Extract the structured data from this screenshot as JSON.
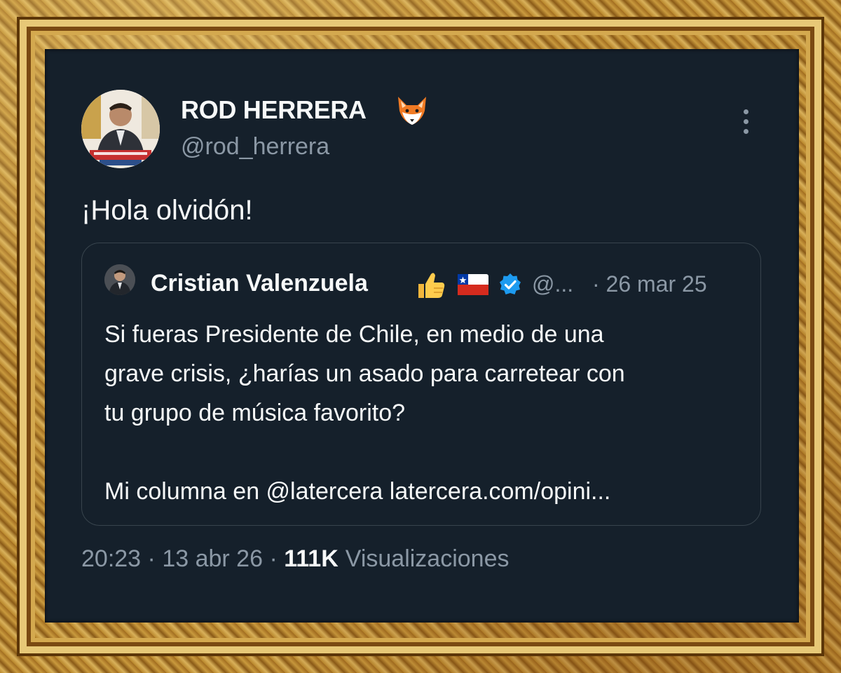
{
  "tweet": {
    "author_name": "ROD HERRERA",
    "author_emoji": "fox-emoji",
    "handle": "@rod_herrera",
    "more_icon": "more-vertical-icon",
    "text": "¡Hola olvidón!",
    "time": "20:23",
    "separator": "·",
    "date": "13 abr 26",
    "views_count": "111K",
    "views_label": "Visualizaciones"
  },
  "quoted": {
    "author_name": "Cristian Valenzuela",
    "emojis": [
      "thumbs-up-emoji",
      "chile-flag-emoji"
    ],
    "verified_icon": "verified-badge-icon",
    "handle": "@...",
    "date": "· 26 mar 25",
    "lines": [
      "Si fueras Presidente de Chile, en medio de una",
      "grave crisis, ¿harías un asado para carretear con",
      "tu grupo de música favorito?"
    ],
    "link_line": "Mi columna en @latercera latercera.com/opini..."
  },
  "colors": {
    "background": "#15202b",
    "text": "#f7f9f9",
    "secondary": "#8b98a5",
    "border": "#38444d",
    "verified": "#1d9bf0",
    "frame": "#c99a3e"
  }
}
